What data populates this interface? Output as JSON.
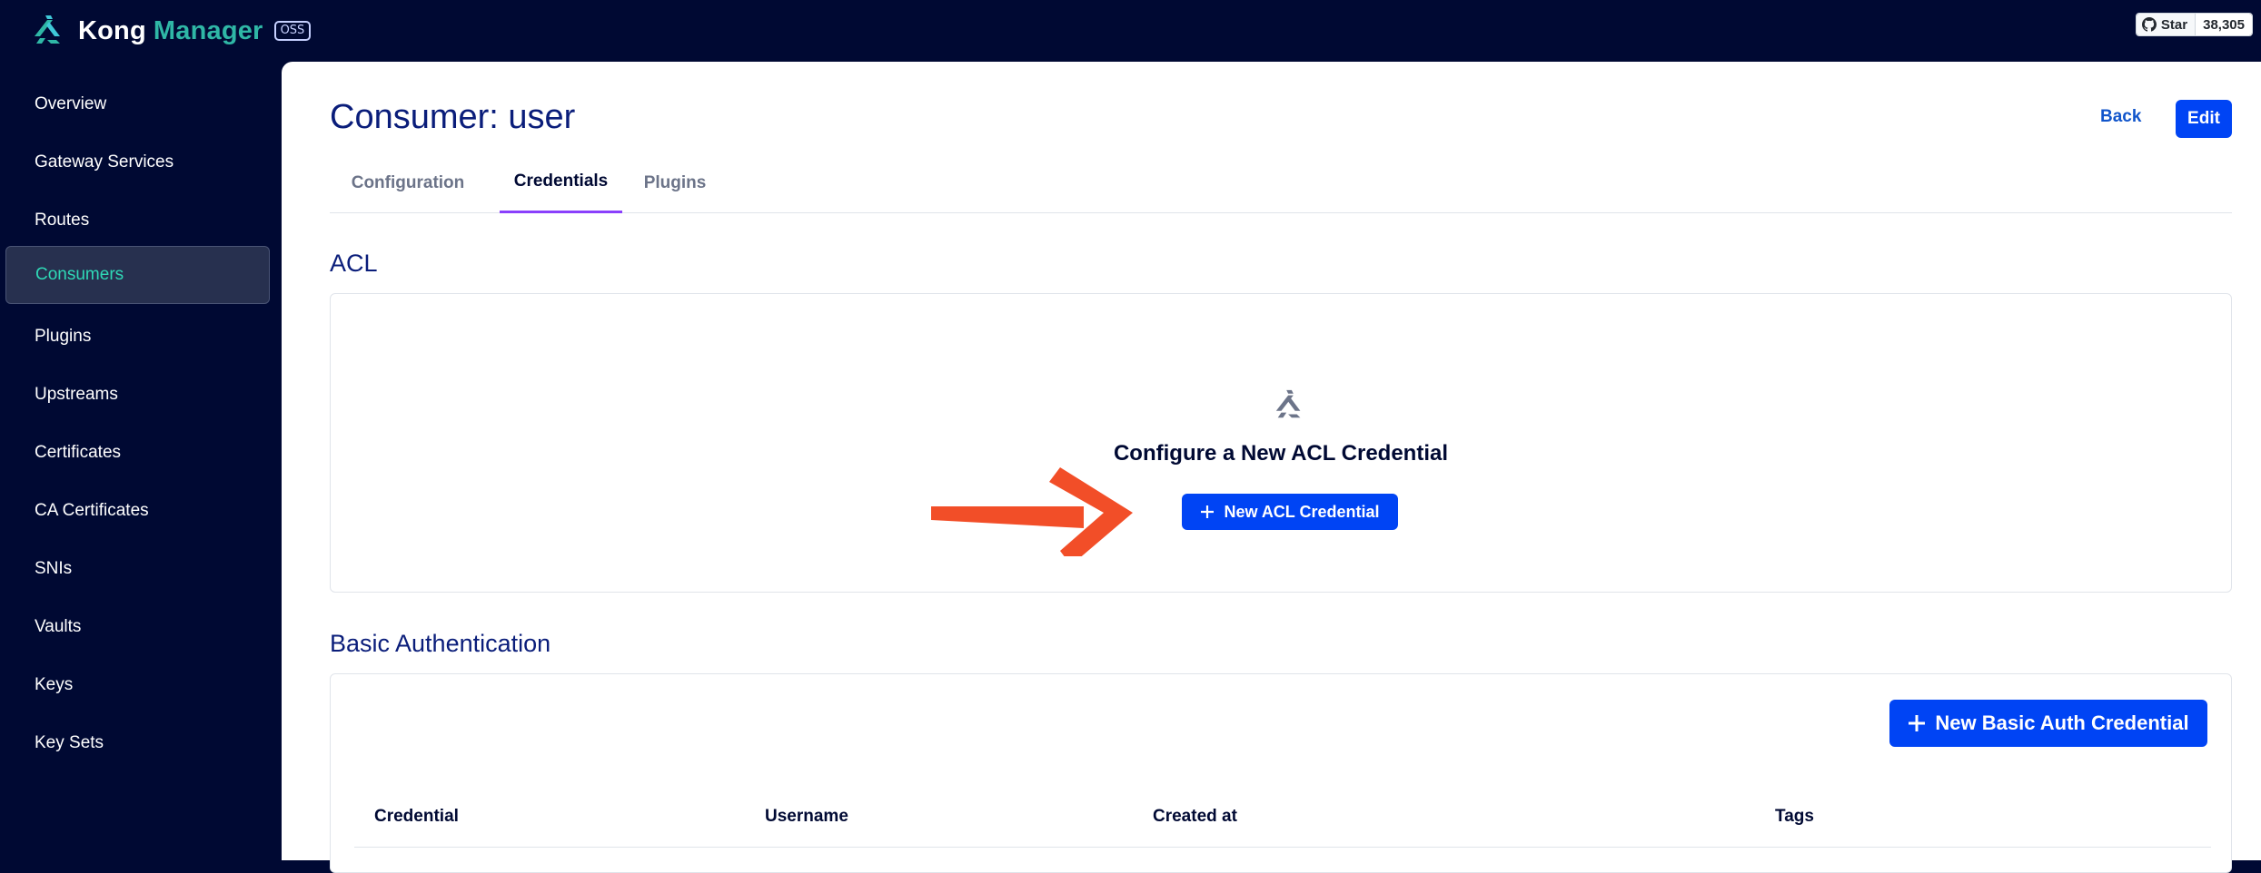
{
  "brand": {
    "name_part1": "Kong",
    "name_part2": "Manager",
    "badge": "OSS"
  },
  "github": {
    "star_label": "Star",
    "count": "38,305",
    "icon": "github-icon"
  },
  "sidebar": {
    "items": [
      {
        "label": "Overview"
      },
      {
        "label": "Gateway Services"
      },
      {
        "label": "Routes"
      },
      {
        "label": "Consumers",
        "active": true
      },
      {
        "label": "Plugins"
      },
      {
        "label": "Upstreams"
      },
      {
        "label": "Certificates"
      },
      {
        "label": "CA Certificates"
      },
      {
        "label": "SNIs"
      },
      {
        "label": "Vaults"
      },
      {
        "label": "Keys"
      },
      {
        "label": "Key Sets"
      }
    ]
  },
  "header": {
    "title": "Consumer: user",
    "back_label": "Back",
    "edit_label": "Edit"
  },
  "tabs": [
    {
      "label": "Configuration"
    },
    {
      "label": "Credentials",
      "active": true
    },
    {
      "label": "Plugins"
    }
  ],
  "acl": {
    "section_title": "ACL",
    "empty_title": "Configure a New ACL Credential",
    "button_label": "New ACL Credential"
  },
  "basic_auth": {
    "section_title": "Basic Authentication",
    "button_label": "New Basic Auth Credential",
    "columns": [
      "Credential",
      "Username",
      "Created at",
      "Tags"
    ]
  },
  "colors": {
    "navy": "#000933",
    "primary": "#0044f4",
    "accent_teal": "#2fd8b6",
    "tab_underline": "#8a3ffc",
    "annotation_arrow": "#f24e28"
  }
}
